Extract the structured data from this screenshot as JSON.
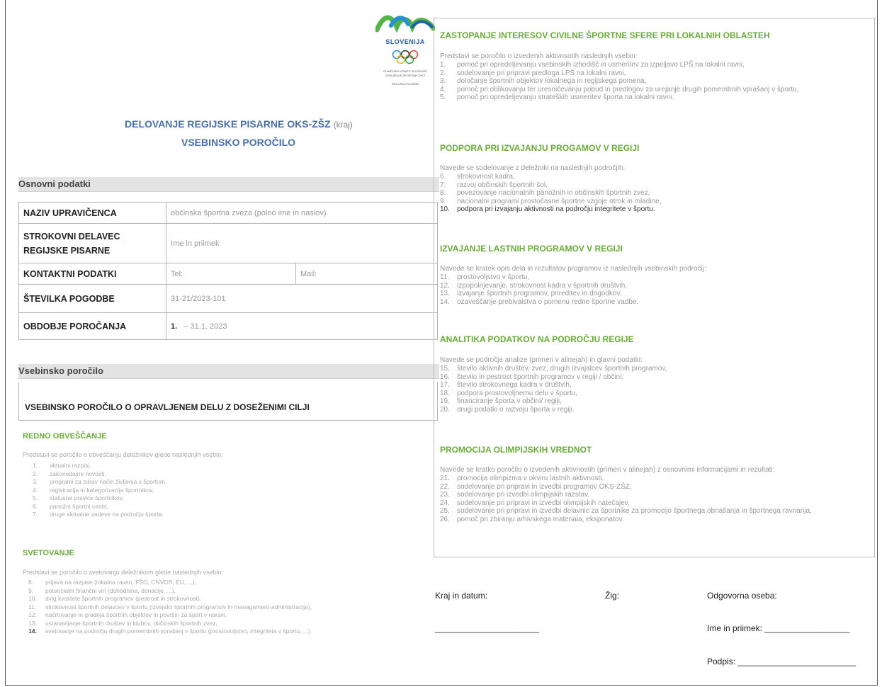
{
  "logo": {
    "country": "SLOVENIJA",
    "line1": "OLIMPIJSKI KOMITE SLOVENIJE",
    "line2": "ZDRUŽENJE ŠPORTNIH ZVEZ",
    "line3": "REGIJSKA PISARNA",
    "colors": [
      "#2a8fd0",
      "#55b447",
      "#1d63a8"
    ]
  },
  "title": {
    "main": "DELOVANJE REGIJSKE PISARNE OKS-ZŠZ",
    "kraj": "(kraj)",
    "sub": "VSEBINSKO POROČILO"
  },
  "osnovni": {
    "heading": "Osnovni podatki",
    "rows": [
      {
        "label": "NAZIV UPRAVIČENCA",
        "value": "občinska športna zveza (polno ime in naslov)"
      },
      {
        "label": "STROKOVNI DELAVEC REGIJSKE PISARNE",
        "value": "Ime in priimek"
      },
      {
        "label": "KONTAKTNI PODATKI",
        "value": "Tel:",
        "value2": "Mail:"
      },
      {
        "label": "ŠTEVILKA POGODBE",
        "value": "31-21/2023-101"
      },
      {
        "label": "OBDOBJE POROČANJA",
        "value_bold": "1.",
        "value": "– 31.1. 2023"
      }
    ]
  },
  "vsebinsko": {
    "heading": "Vsebinsko poročilo",
    "subheading": "VSEBINSKO POROČILO O OPRAVLJENEM DELU Z DOSEŽENIMI CILJI",
    "redno": {
      "title": "REDNO OBVEŠČANJE",
      "intro": "Predstavi se poročilo o obveščanju deležnikov glede naslednjih vsebin:",
      "items": [
        {
          "n": "1.",
          "t": "aktualni razpisi,"
        },
        {
          "n": "2.",
          "t": "zakonodajne novosti,"
        },
        {
          "n": "3.",
          "t": "programi za zdrav način življenja s športom,"
        },
        {
          "n": "4.",
          "t": "registracija in kategorizacija športnikov,"
        },
        {
          "n": "5.",
          "t": "statusne pravice športnikov,"
        },
        {
          "n": "6.",
          "t": "panožni športni centri,"
        },
        {
          "n": "7.",
          "t": "druge aktualne zadeve na področju športa."
        }
      ]
    },
    "svetovanje": {
      "title": "SVETOVANJE",
      "intro": "Predstavi se poročilo o svetovanju deležnikom glede naslednjih vsebin:",
      "items": [
        {
          "n": "8.",
          "t": "prijava na razpise (lokalna raven, FŠO, CNVOS, EU, ...),"
        },
        {
          "n": "9.",
          "t": "potencialni finančni viri (dohodnina, donacije, ...),"
        },
        {
          "n": "10.",
          "t": "dvig kvalitete športnih programov (pestrost in strokovnost),"
        },
        {
          "n": "11.",
          "t": "strokovnost športnih delavcev v športu (izvajalci športnih programov in managament-administracija),"
        },
        {
          "n": "12.",
          "t": "načrtovanje in gradnja športnih objektov in površin za šport v naravi,"
        },
        {
          "n": "13.",
          "t": "ustanavljanje športnih društev in klubov, občinskih športnih zvez,"
        },
        {
          "n": "14.",
          "t": "svetovanje na področju drugih pomembnih vprašanj v športu (prostovoljstvo, integriteta v športu, ...).",
          "bold_n": true
        }
      ]
    }
  },
  "right": {
    "sections": [
      {
        "title": "ZASTOPANJE INTERESOV CIVILNE ŠPORTNE SFERE PRI LOKALNIH OBLASTEH",
        "intro": "Predstavi se poročilo o izvedenih aktivnsotih naslednjih vsebin:",
        "items": [
          {
            "n": "1.",
            "t": "pomoč pri opredeljevanju vsebinskih izhodišč in usmeritev za izpeljavo LPŠ na lokalni ravni,"
          },
          {
            "n": "2.",
            "t": "sodelovanje pri pripravi predloga LPŠ na lokalni ravni,"
          },
          {
            "n": "3.",
            "t": "določanje športnih objektov lokalnega in regijskega pomena,"
          },
          {
            "n": "4.",
            "t": "pomoč pri oblikovanju ter uresničevanju pobud in predlogov za urejanje drugih pomembnih vprašanj v športu,"
          },
          {
            "n": "5.",
            "t": "pomoč pri opredeljevanju strateških usmeritev športa na lokalni ravni."
          }
        ]
      },
      {
        "title": "PODPORA PRI IZVAJANJU PROGAMOV V REGIJI",
        "intro": "Navede se sodelovanje z deležniki na naslednjih področjih:",
        "items": [
          {
            "n": "6.",
            "t": "strokovnost kadra,"
          },
          {
            "n": "7.",
            "t": "razvoj občinskih športnih šol,"
          },
          {
            "n": "8.",
            "t": "povezovanje nacionalnih panožnih in občinskih športnih zvez,"
          },
          {
            "n": "9.",
            "t": "nacionalni programi prostočasne športne vzgoje otrok in mladine,"
          },
          {
            "n": "10.",
            "t": "podpora pri izvajanju aktivnosti na področju integritete v športu.",
            "dark": true
          }
        ]
      },
      {
        "title": "IZVAJANJE LASTNIH PROGRAMOV V REGIJI",
        "intro": "Navede se kratek opis dela in rezultatov programov iz naslednjih vsebinskih področij:",
        "items": [
          {
            "n": "11.",
            "t": "prostovoljstvo v športu,"
          },
          {
            "n": "12.",
            "t": "izpopolnjevanje, strokovnost kadra v športnih društvih,"
          },
          {
            "n": "13.",
            "t": "izvajanje športnih programov, prireditev in dogodkov,"
          },
          {
            "n": "14.",
            "t": "ozaveščanje prebivalstva o pomenu redne športne vadbe."
          }
        ]
      },
      {
        "title": "ANALITIKA PODATKOV NA PODROČJU REGIJE",
        "intro": "Navede se področje analize (primeri v alinejah) in glavni podatki:",
        "items": [
          {
            "n": "15.",
            "t": "število aktivnih društev, zvez, drugih izvajalcev športnih programov,"
          },
          {
            "n": "16.",
            "t": "število in pestrost športnih programov v regiji / občini,"
          },
          {
            "n": "17.",
            "t": "število strokovnega kadra v društvih,"
          },
          {
            "n": "18.",
            "t": "podpora prostovoljnemu delu v športu,"
          },
          {
            "n": "19.",
            "t": "financiranje športa v občini/ regiji,"
          },
          {
            "n": "20.",
            "t": "drugi podatki o razvoju športa v regiji."
          }
        ]
      },
      {
        "title": "PROMOCIJA OLIMPIJSKIH VREDNOT",
        "intro": "Navede se kratko poročilo o izvedenih aktivnostih (primeri v alinejah)  z osnovnimi informacijami in rezultati:",
        "items": [
          {
            "n": "21.",
            "t": "promocija olimpizma v okviru lastnih aktivnosti,"
          },
          {
            "n": "22.",
            "t": "sodelovanje pri pripravi in izvedbi programov OKS-ZŠZ,"
          },
          {
            "n": "23.",
            "t": "sodelovanje pri izvedbi olimpijskih razstav,"
          },
          {
            "n": "24.",
            "t": "sodelovanje pri pripravi in izvedbi olimpijskih natečajev,"
          },
          {
            "n": "25.",
            "t": "sodelovanje pri pripravi in izvedbi delavnic za športnike za promocijo športnega obnašanja in športnega ravnanja,"
          },
          {
            "n": "26.",
            "t": "pomoč pri zbiranju arhivskega materiala, eksponatov."
          }
        ]
      }
    ]
  },
  "signature": {
    "kraj_datum": "Kraj in datum:",
    "zig": "Žig:",
    "odgovorna": "Odgovorna oseba:",
    "line_kraj": "______________________",
    "ime": "Ime in priimek: __________________",
    "podpis": "Podpis: _________________________"
  }
}
